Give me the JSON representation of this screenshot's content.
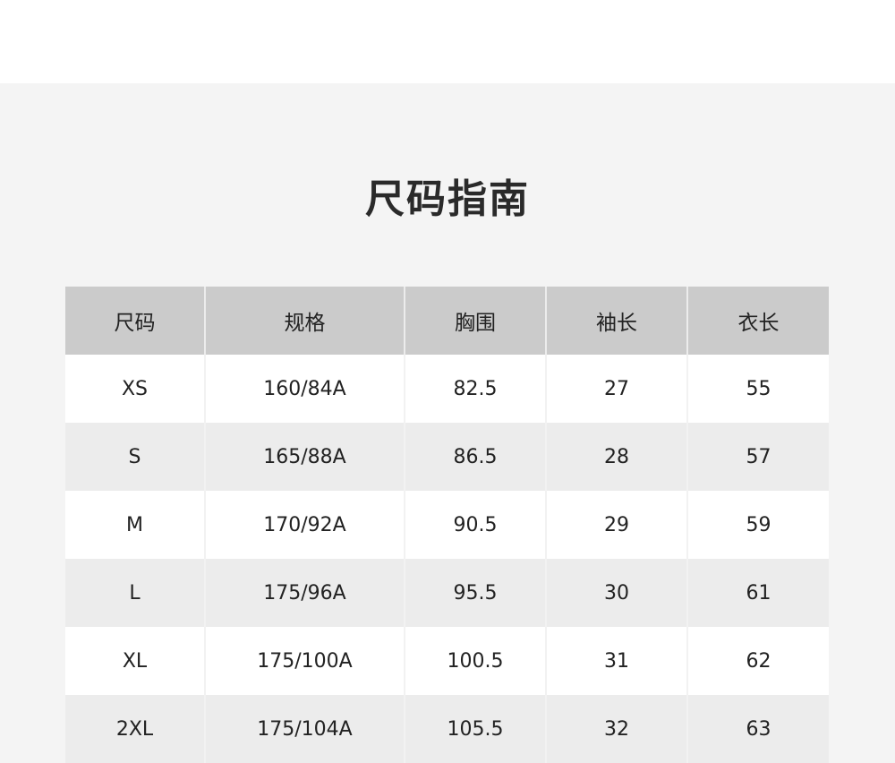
{
  "title": "尺码指南",
  "table": {
    "headers": [
      "尺码",
      "规格",
      "胸围",
      "袖长",
      "衣长"
    ],
    "rows": [
      [
        "XS",
        "160/84A",
        "82.5",
        "27",
        "55"
      ],
      [
        "S",
        "165/88A",
        "86.5",
        "28",
        "57"
      ],
      [
        "M",
        "170/92A",
        "90.5",
        "29",
        "59"
      ],
      [
        "L",
        "175/96A",
        "95.5",
        "30",
        "61"
      ],
      [
        "XL",
        "175/100A",
        "100.5",
        "31",
        "62"
      ],
      [
        "2XL",
        "175/104A",
        "105.5",
        "32",
        "63"
      ]
    ]
  },
  "colors": {
    "panel_bg": "#f4f4f4",
    "header_bg": "#cbcbcb",
    "row_alt_bg": "#ececec",
    "text": "#222222"
  }
}
